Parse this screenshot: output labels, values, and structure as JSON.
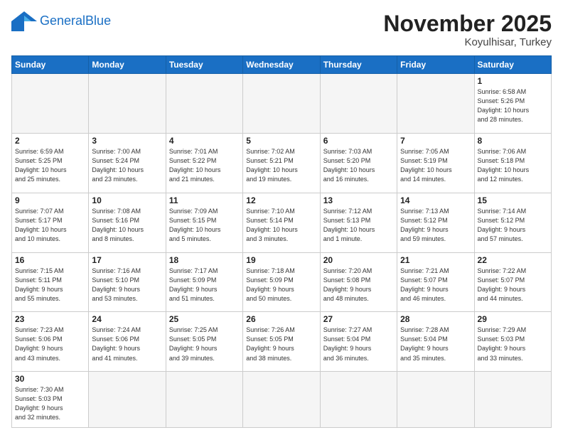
{
  "header": {
    "logo_general": "General",
    "logo_blue": "Blue",
    "month_title": "November 2025",
    "location": "Koyulhisar, Turkey"
  },
  "days_of_week": [
    "Sunday",
    "Monday",
    "Tuesday",
    "Wednesday",
    "Thursday",
    "Friday",
    "Saturday"
  ],
  "weeks": [
    [
      {
        "day": "",
        "info": ""
      },
      {
        "day": "",
        "info": ""
      },
      {
        "day": "",
        "info": ""
      },
      {
        "day": "",
        "info": ""
      },
      {
        "day": "",
        "info": ""
      },
      {
        "day": "",
        "info": ""
      },
      {
        "day": "1",
        "info": "Sunrise: 6:58 AM\nSunset: 5:26 PM\nDaylight: 10 hours\nand 28 minutes."
      }
    ],
    [
      {
        "day": "2",
        "info": "Sunrise: 6:59 AM\nSunset: 5:25 PM\nDaylight: 10 hours\nand 25 minutes."
      },
      {
        "day": "3",
        "info": "Sunrise: 7:00 AM\nSunset: 5:24 PM\nDaylight: 10 hours\nand 23 minutes."
      },
      {
        "day": "4",
        "info": "Sunrise: 7:01 AM\nSunset: 5:22 PM\nDaylight: 10 hours\nand 21 minutes."
      },
      {
        "day": "5",
        "info": "Sunrise: 7:02 AM\nSunset: 5:21 PM\nDaylight: 10 hours\nand 19 minutes."
      },
      {
        "day": "6",
        "info": "Sunrise: 7:03 AM\nSunset: 5:20 PM\nDaylight: 10 hours\nand 16 minutes."
      },
      {
        "day": "7",
        "info": "Sunrise: 7:05 AM\nSunset: 5:19 PM\nDaylight: 10 hours\nand 14 minutes."
      },
      {
        "day": "8",
        "info": "Sunrise: 7:06 AM\nSunset: 5:18 PM\nDaylight: 10 hours\nand 12 minutes."
      }
    ],
    [
      {
        "day": "9",
        "info": "Sunrise: 7:07 AM\nSunset: 5:17 PM\nDaylight: 10 hours\nand 10 minutes."
      },
      {
        "day": "10",
        "info": "Sunrise: 7:08 AM\nSunset: 5:16 PM\nDaylight: 10 hours\nand 8 minutes."
      },
      {
        "day": "11",
        "info": "Sunrise: 7:09 AM\nSunset: 5:15 PM\nDaylight: 10 hours\nand 5 minutes."
      },
      {
        "day": "12",
        "info": "Sunrise: 7:10 AM\nSunset: 5:14 PM\nDaylight: 10 hours\nand 3 minutes."
      },
      {
        "day": "13",
        "info": "Sunrise: 7:12 AM\nSunset: 5:13 PM\nDaylight: 10 hours\nand 1 minute."
      },
      {
        "day": "14",
        "info": "Sunrise: 7:13 AM\nSunset: 5:12 PM\nDaylight: 9 hours\nand 59 minutes."
      },
      {
        "day": "15",
        "info": "Sunrise: 7:14 AM\nSunset: 5:12 PM\nDaylight: 9 hours\nand 57 minutes."
      }
    ],
    [
      {
        "day": "16",
        "info": "Sunrise: 7:15 AM\nSunset: 5:11 PM\nDaylight: 9 hours\nand 55 minutes."
      },
      {
        "day": "17",
        "info": "Sunrise: 7:16 AM\nSunset: 5:10 PM\nDaylight: 9 hours\nand 53 minutes."
      },
      {
        "day": "18",
        "info": "Sunrise: 7:17 AM\nSunset: 5:09 PM\nDaylight: 9 hours\nand 51 minutes."
      },
      {
        "day": "19",
        "info": "Sunrise: 7:18 AM\nSunset: 5:09 PM\nDaylight: 9 hours\nand 50 minutes."
      },
      {
        "day": "20",
        "info": "Sunrise: 7:20 AM\nSunset: 5:08 PM\nDaylight: 9 hours\nand 48 minutes."
      },
      {
        "day": "21",
        "info": "Sunrise: 7:21 AM\nSunset: 5:07 PM\nDaylight: 9 hours\nand 46 minutes."
      },
      {
        "day": "22",
        "info": "Sunrise: 7:22 AM\nSunset: 5:07 PM\nDaylight: 9 hours\nand 44 minutes."
      }
    ],
    [
      {
        "day": "23",
        "info": "Sunrise: 7:23 AM\nSunset: 5:06 PM\nDaylight: 9 hours\nand 43 minutes."
      },
      {
        "day": "24",
        "info": "Sunrise: 7:24 AM\nSunset: 5:06 PM\nDaylight: 9 hours\nand 41 minutes."
      },
      {
        "day": "25",
        "info": "Sunrise: 7:25 AM\nSunset: 5:05 PM\nDaylight: 9 hours\nand 39 minutes."
      },
      {
        "day": "26",
        "info": "Sunrise: 7:26 AM\nSunset: 5:05 PM\nDaylight: 9 hours\nand 38 minutes."
      },
      {
        "day": "27",
        "info": "Sunrise: 7:27 AM\nSunset: 5:04 PM\nDaylight: 9 hours\nand 36 minutes."
      },
      {
        "day": "28",
        "info": "Sunrise: 7:28 AM\nSunset: 5:04 PM\nDaylight: 9 hours\nand 35 minutes."
      },
      {
        "day": "29",
        "info": "Sunrise: 7:29 AM\nSunset: 5:03 PM\nDaylight: 9 hours\nand 33 minutes."
      }
    ],
    [
      {
        "day": "30",
        "info": "Sunrise: 7:30 AM\nSunset: 5:03 PM\nDaylight: 9 hours\nand 32 minutes."
      },
      {
        "day": "",
        "info": ""
      },
      {
        "day": "",
        "info": ""
      },
      {
        "day": "",
        "info": ""
      },
      {
        "day": "",
        "info": ""
      },
      {
        "day": "",
        "info": ""
      },
      {
        "day": "",
        "info": ""
      }
    ]
  ]
}
